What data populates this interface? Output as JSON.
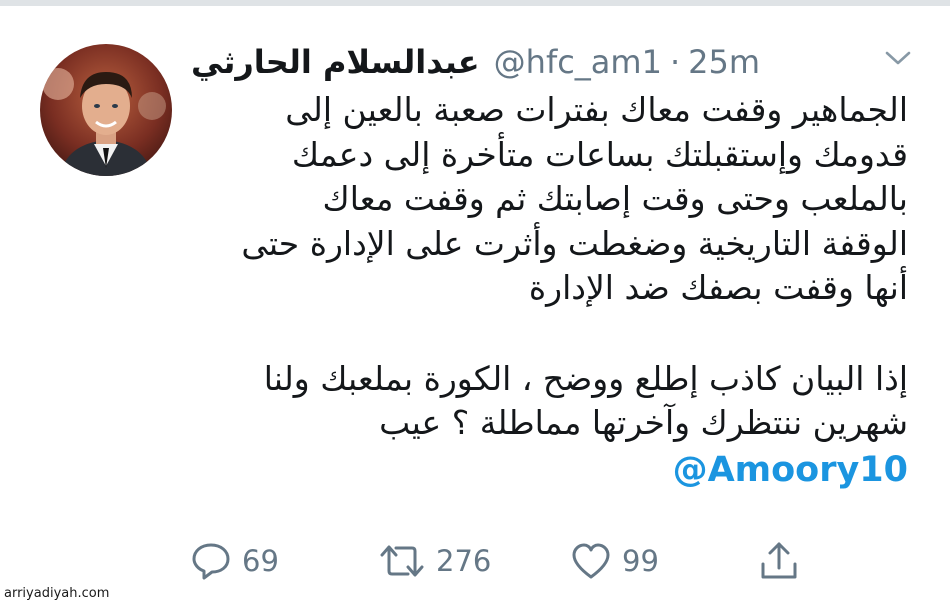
{
  "tweet": {
    "author_name": "عبدالسلام الحارثي",
    "handle": "@hfc_am1",
    "separator": "·",
    "time": "25m",
    "text_lines": [
      "الجماهير وقفت معاك بفترات صعبة بالعين إلى",
      "قدومك وإستقبلتك بساعات متأخرة إلى دعمك",
      "بالملعب وحتى وقت إصابتك ثم وقفت معاك",
      "الوقفة التاريخية وضغطت وأثرت على الإدارة حتى",
      "أنها وقفت بصفك ضد الإدارة"
    ],
    "text_lines_2": [
      "إذا البيان كاذب إطلع ووضح ، الكورة بملعبك ولنا",
      "شهرين ننتظرك وآخرتها مماطلة ؟ عيب"
    ],
    "mention": "@Amoory10",
    "reply_count": "69",
    "retweet_count": "276",
    "like_count": "99"
  },
  "icons": {
    "caret": "chevron-down-icon",
    "reply": "reply-icon",
    "retweet": "retweet-icon",
    "like": "heart-icon",
    "share": "share-icon"
  },
  "colors": {
    "text": "#14171a",
    "secondary": "#657786",
    "link": "#1b95e0",
    "background": "#ffffff"
  },
  "watermark": "arriyadiyah.com"
}
